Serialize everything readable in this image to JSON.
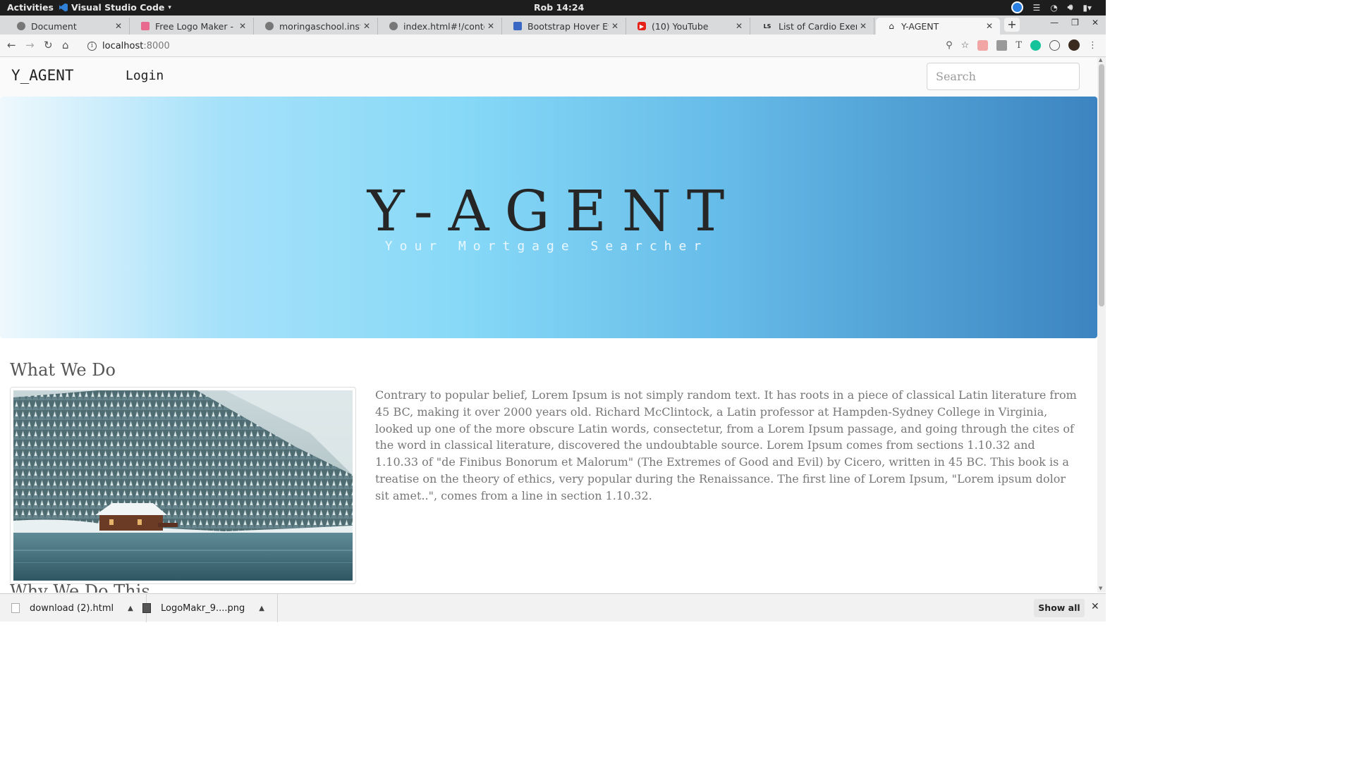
{
  "os_bar": {
    "activities": "Activities",
    "app_name": "Visual Studio Code",
    "clock": "Rob 14:24"
  },
  "browser": {
    "tabs": [
      {
        "title": "Document",
        "icon": "globe-icon"
      },
      {
        "title": "Free Logo Maker - Create",
        "icon": "logomaker-icon"
      },
      {
        "title": "moringaschool.instructure",
        "icon": "globe-icon"
      },
      {
        "title": "index.html#!/content",
        "icon": "globe-icon"
      },
      {
        "title": "Bootstrap Hover Effects",
        "icon": "bootstrap-icon"
      },
      {
        "title": "(10) YouTube",
        "icon": "youtube-icon"
      },
      {
        "title": "List of Cardio Exercises",
        "icon": "ls-icon"
      },
      {
        "title": "Y-AGENT",
        "icon": "home-icon",
        "active": true
      }
    ],
    "address": {
      "host": "localhost",
      "port": ":8000"
    }
  },
  "site": {
    "brand": "Y_AGENT",
    "nav_login": "Login",
    "search_placeholder": "Search",
    "hero_title": "Y-AGENT",
    "hero_tagline": "Your Mortgage Searcher",
    "section1_title": "What We Do",
    "section1_text": "Contrary to popular belief, Lorem Ipsum is not simply random text. It has roots in a piece of classical Latin literature from 45 BC, making it over 2000 years old. Richard McClintock, a Latin professor at Hampden-Sydney College in Virginia, looked up one of the more obscure Latin words, consectetur, from a Lorem Ipsum passage, and going through the cites of the word in classical literature, discovered the undoubtable source. Lorem Ipsum comes from sections 1.10.32 and 1.10.33 of \"de Finibus Bonorum et Malorum\" (The Extremes of Good and Evil) by Cicero, written in 45 BC. This book is a treatise on the theory of ethics, very popular during the Renaissance. The first line of Lorem Ipsum, \"Lorem ipsum dolor sit amet..\", comes from a line in section 1.10.32.",
    "section2_title": "Why We Do This",
    "hero_gradient": [
      "#eef8fd",
      "#87d9f7",
      "#3c84c1"
    ]
  },
  "downloads": {
    "items": [
      {
        "name": "download (2).html"
      },
      {
        "name": "LogoMakr_9....png"
      }
    ],
    "show_all": "Show all"
  }
}
